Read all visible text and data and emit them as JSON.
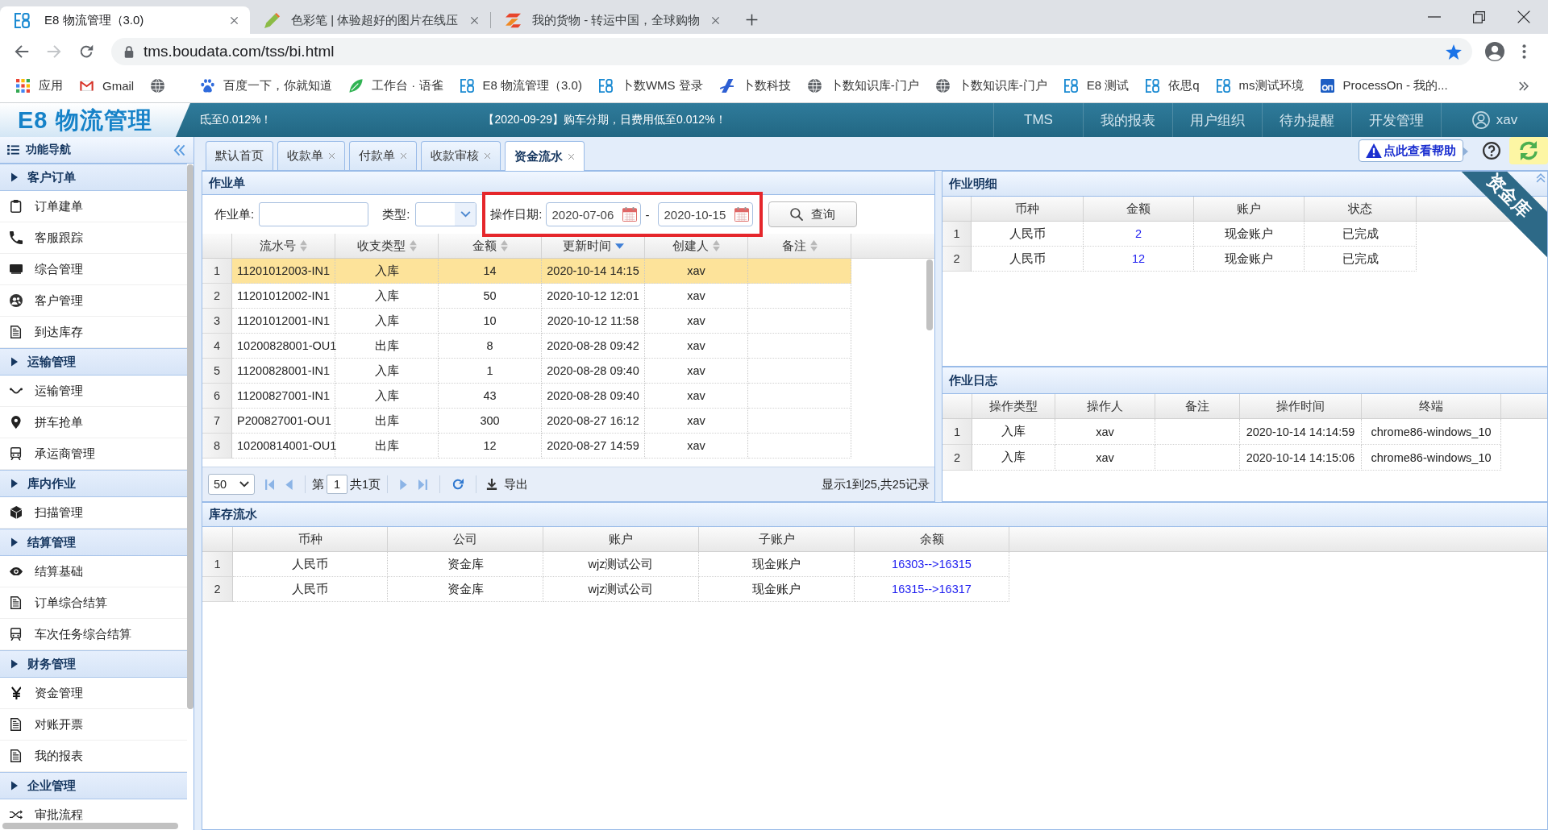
{
  "browser": {
    "tabs": [
      {
        "title": "E8 物流管理（3.0)",
        "kind": "logo",
        "selected": true
      },
      {
        "title": "色彩笔 | 体验超好的图片在线压",
        "kind": "pen",
        "selected": false
      },
      {
        "title": "我的货物 - 转运中国，全球购物",
        "kind": "bars",
        "selected": false
      }
    ],
    "forward_disabled": true,
    "url": "tms.boudata.com/tss/bi.html",
    "bookmarks": [
      {
        "label": "应用",
        "kind": "apps"
      },
      {
        "label": "Gmail",
        "kind": "mail"
      },
      {
        "kind": "globe"
      },
      {
        "label": "百度一下，你就知道",
        "kind": "paw"
      },
      {
        "label": "工作台 · 语雀",
        "kind": "leaf"
      },
      {
        "label": "E8 物流管理（3.0)",
        "kind": "logo"
      },
      {
        "label": "卜数WMS 登录",
        "kind": "logo"
      },
      {
        "label": "卜数科技",
        "kind": "swoosh"
      },
      {
        "label": "卜数知识库-门户",
        "kind": "globe"
      },
      {
        "label": "卜数知识库-门户",
        "kind": "globe"
      },
      {
        "label": "E8 测试",
        "kind": "logo"
      },
      {
        "label": "依思q",
        "kind": "logo"
      },
      {
        "label": "ms测试环境",
        "kind": "logo"
      },
      {
        "label": "ProcessOn - 我的...",
        "kind": "tile"
      }
    ]
  },
  "app": {
    "logo": "E8 物流管理",
    "notices": [
      "氐至0.012%！",
      "【2020-09-29】购车分期，日费用低至0.012%！"
    ],
    "nav": [
      "TMS",
      "我的报表",
      "用户组织",
      "待办提醒",
      "开发管理"
    ],
    "user": "xav"
  },
  "sidebar": {
    "title": "功能导航",
    "groups": [
      {
        "label": "客户订单",
        "items": [
          {
            "label": "订单建单",
            "kind": "clipboard"
          },
          {
            "label": "客服跟踪",
            "kind": "phone"
          },
          {
            "label": "综合管理",
            "kind": "monitor"
          },
          {
            "label": "客户管理",
            "kind": "users"
          },
          {
            "label": "到达库存",
            "kind": "document"
          }
        ]
      },
      {
        "label": "运输管理",
        "items": [
          {
            "label": "运输管理",
            "kind": "route"
          },
          {
            "label": "拼车抢单",
            "kind": "pin"
          },
          {
            "label": "承运商管理",
            "kind": "train"
          }
        ]
      },
      {
        "label": "库内作业",
        "items": [
          {
            "label": "扫描管理",
            "kind": "cube"
          }
        ]
      },
      {
        "label": "结算管理",
        "items": [
          {
            "label": "结算基础",
            "kind": "eye"
          },
          {
            "label": "订单综合结算",
            "kind": "document"
          },
          {
            "label": "车次任务综合结算",
            "kind": "train"
          }
        ]
      },
      {
        "label": "财务管理",
        "items": [
          {
            "label": "资金管理",
            "kind": "yen"
          },
          {
            "label": "对账开票",
            "kind": "document"
          },
          {
            "label": "我的报表",
            "kind": "document"
          }
        ]
      },
      {
        "label": "企业管理",
        "items": [
          {
            "label": "审批流程",
            "kind": "shuffle"
          }
        ]
      }
    ]
  },
  "tabs": [
    {
      "label": "默认首页",
      "closable": false,
      "selected": false
    },
    {
      "label": "收款单",
      "closable": true,
      "selected": false
    },
    {
      "label": "付款单",
      "closable": true,
      "selected": false
    },
    {
      "label": "收款审核",
      "closable": true,
      "selected": false
    },
    {
      "label": "资金流水",
      "closable": true,
      "selected": true
    }
  ],
  "help": {
    "label": "点此查看帮助"
  },
  "work_orders": {
    "title": "作业单",
    "filters": {
      "order_label": "作业单:",
      "type_label": "类型:",
      "date_label": "操作日期:",
      "date_from": "2020-07-06",
      "date_separator": "-",
      "date_to": "2020-10-15",
      "highlighted": true
    },
    "search_button": "查询",
    "table": {
      "columns": [
        {
          "label": "流水号",
          "kind": "text",
          "sorted": false
        },
        {
          "label": "收支类型",
          "kind": "text",
          "sorted": false
        },
        {
          "label": "金额",
          "kind": "text",
          "sorted": false
        },
        {
          "label": "更新时间",
          "kind": "text",
          "sorted": true
        },
        {
          "label": "创建人",
          "kind": "text",
          "sorted": false
        },
        {
          "label": "备注",
          "kind": "text",
          "sorted": false
        }
      ],
      "rows": [
        {
          "no": "1",
          "cells": [
            "11201012003-IN1",
            "入库",
            "14",
            "2020-10-14 14:15",
            "xav"
          ],
          "selected": true
        },
        {
          "no": "2",
          "cells": [
            "11201012002-IN1",
            "入库",
            "50",
            "2020-10-12 12:01",
            "xav"
          ],
          "selected": false
        },
        {
          "no": "3",
          "cells": [
            "11201012001-IN1",
            "入库",
            "10",
            "2020-10-12 11:58",
            "xav"
          ],
          "selected": false
        },
        {
          "no": "4",
          "cells": [
            "10200828001-OU1",
            "出库",
            "8",
            "2020-08-28 09:42",
            "xav"
          ],
          "selected": false
        },
        {
          "no": "5",
          "cells": [
            "11200828001-IN1",
            "入库",
            "1",
            "2020-08-28 09:40",
            "xav"
          ],
          "selected": false
        },
        {
          "no": "6",
          "cells": [
            "11200827001-IN1",
            "入库",
            "43",
            "2020-08-28 09:40",
            "xav"
          ],
          "selected": false
        },
        {
          "no": "7",
          "cells": [
            "P200827001-OU1",
            "出库",
            "300",
            "2020-08-27 16:12",
            "xav"
          ],
          "selected": false
        },
        {
          "no": "8",
          "cells": [
            "10200814001-OU1",
            "出库",
            "12",
            "2020-08-27 14:59",
            "xav"
          ],
          "selected": false
        }
      ]
    },
    "pager": {
      "page_size": "50",
      "page_prefix": "第",
      "page": "1",
      "page_suffix": "共1页",
      "export": "导出",
      "summary": "显示1到25,共25记录"
    }
  },
  "detail": {
    "title": "作业明细",
    "table": {
      "columns": [
        {
          "label": "币种",
          "kind": "text"
        },
        {
          "label": "金额",
          "kind": "link"
        },
        {
          "label": "账户",
          "kind": "text"
        },
        {
          "label": "状态",
          "kind": "text"
        }
      ],
      "rows": [
        {
          "no": "1",
          "cells": [
            "人民币",
            "2",
            "现金账户",
            "已完成"
          ]
        },
        {
          "no": "2",
          "cells": [
            "人民币",
            "12",
            "现金账户",
            "已完成"
          ]
        }
      ]
    }
  },
  "log": {
    "title": "作业日志",
    "table": {
      "columns": [
        {
          "label": "操作类型",
          "kind": "text"
        },
        {
          "label": "操作人",
          "kind": "text"
        },
        {
          "label": "备注",
          "kind": "text"
        },
        {
          "label": "操作时间",
          "kind": "text"
        },
        {
          "label": "终端",
          "kind": "text"
        }
      ],
      "rows": [
        {
          "no": "1",
          "cells": [
            "入库",
            "xav",
            null,
            "2020-10-14 14:14:59",
            "chrome86-windows_10"
          ]
        },
        {
          "no": "2",
          "cells": [
            "入库",
            "xav",
            null,
            "2020-10-14 14:15:06",
            "chrome86-windows_10"
          ]
        }
      ]
    }
  },
  "stock": {
    "title": "库存流水",
    "table": {
      "columns": [
        {
          "label": "币种",
          "kind": "text"
        },
        {
          "label": "公司",
          "kind": "text"
        },
        {
          "label": "账户",
          "kind": "text"
        },
        {
          "label": "子账户",
          "kind": "text"
        },
        {
          "label": "余额",
          "kind": "link"
        }
      ],
      "rows": [
        {
          "no": "1",
          "cells": [
            "人民币",
            "资金库",
            "wjz测试公司",
            "现金账户",
            "16303-->16315"
          ]
        },
        {
          "no": "2",
          "cells": [
            "人民币",
            "资金库",
            "wjz测试公司",
            "现金账户",
            "16315-->16317"
          ]
        }
      ]
    }
  },
  "ribbon": "资金库"
}
